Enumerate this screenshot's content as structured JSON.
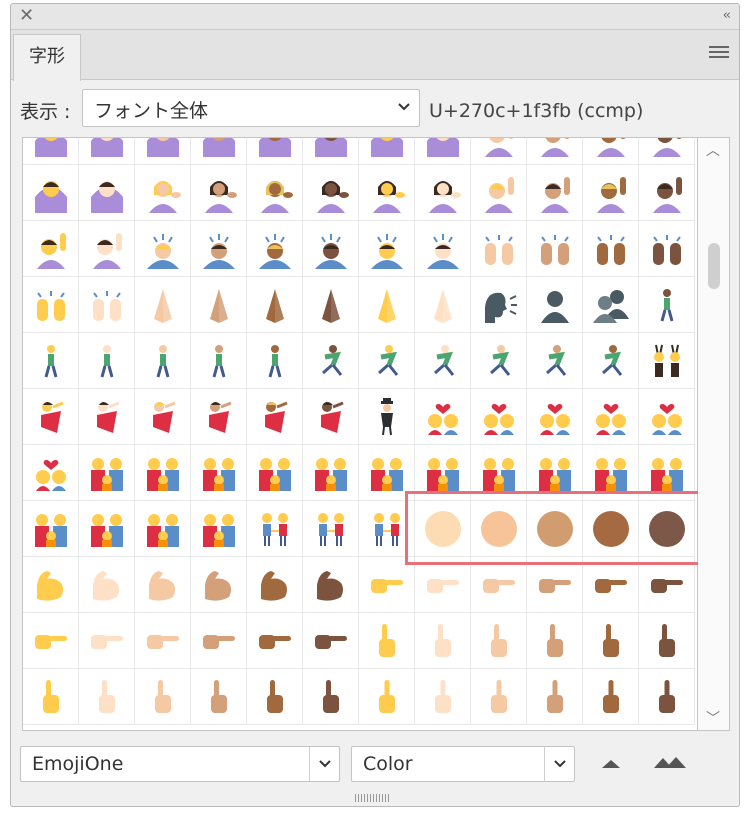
{
  "panel": {
    "tab_label": "字形",
    "show_label": "表示 :",
    "show_value": "フォント全体",
    "unicode_info": "U+270c+1f3fb (ccmp)"
  },
  "bottom": {
    "font_value": "EmojiOne",
    "style_value": "Color"
  },
  "colors": {
    "highlight": "#e8707a",
    "skin_tones": [
      "#fddcb4",
      "#f7c49a",
      "#d29c71",
      "#a66a42",
      "#7d5848"
    ]
  },
  "glyph_rows": [
    [
      "woman-purple",
      "woman-purple",
      "gesture-ok",
      "gesture-ok",
      "gesture-ok",
      "gesture-ok",
      "gesture-ok",
      "gesture-ok",
      "raise-hand",
      "raise-hand",
      "raise-hand",
      "raise-hand"
    ],
    [
      "woman-purple",
      "woman-purple",
      "tipping-hand",
      "tipping-hand",
      "tipping-hand",
      "tipping-hand",
      "tipping-hand",
      "tipping-hand",
      "raise-hand",
      "raise-hand",
      "raise-hand",
      "raise-hand"
    ],
    [
      "raise-hand",
      "raise-hand",
      "bow",
      "bow",
      "bow",
      "bow",
      "bow",
      "bow",
      "raised-hands",
      "raised-hands",
      "raised-hands",
      "raised-hands"
    ],
    [
      "raised-hands",
      "raised-hands",
      "pray",
      "pray",
      "pray",
      "pray",
      "pray",
      "pray",
      "speaking-head",
      "silhouette",
      "silhouettes",
      "walker"
    ],
    [
      "walker",
      "walker",
      "walker",
      "walker",
      "walker",
      "runner",
      "runner",
      "runner",
      "runner",
      "runner",
      "runner",
      "bunnies"
    ],
    [
      "dancer",
      "dancer",
      "dancer",
      "dancer",
      "dancer",
      "dancer",
      "levitate",
      "kiss-couple",
      "kiss-couple",
      "kiss-couple",
      "kiss-couple",
      "couple"
    ],
    [
      "kiss-couple",
      "family",
      "family",
      "family",
      "family",
      "family",
      "family",
      "family",
      "family",
      "family",
      "family",
      "family"
    ],
    [
      "family",
      "family",
      "family",
      "family",
      "holding-hands",
      "holding-hands",
      "holding-hands",
      "tone",
      "tone",
      "tone",
      "tone",
      "tone"
    ],
    [
      "bicep",
      "bicep",
      "bicep",
      "bicep",
      "bicep",
      "bicep",
      "point-right",
      "point-right",
      "point-right",
      "point-right",
      "point-right",
      "point-right"
    ],
    [
      "point-right",
      "point-right",
      "point-right",
      "point-right",
      "point-right",
      "point-right",
      "point-up",
      "point-up",
      "point-up",
      "point-up",
      "point-up",
      "point-up"
    ],
    [
      "point-up",
      "point-up",
      "point-up",
      "point-up",
      "point-up",
      "point-up",
      "middle-finger",
      "middle-finger",
      "middle-finger",
      "middle-finger",
      "middle-finger",
      "middle-finger"
    ]
  ]
}
